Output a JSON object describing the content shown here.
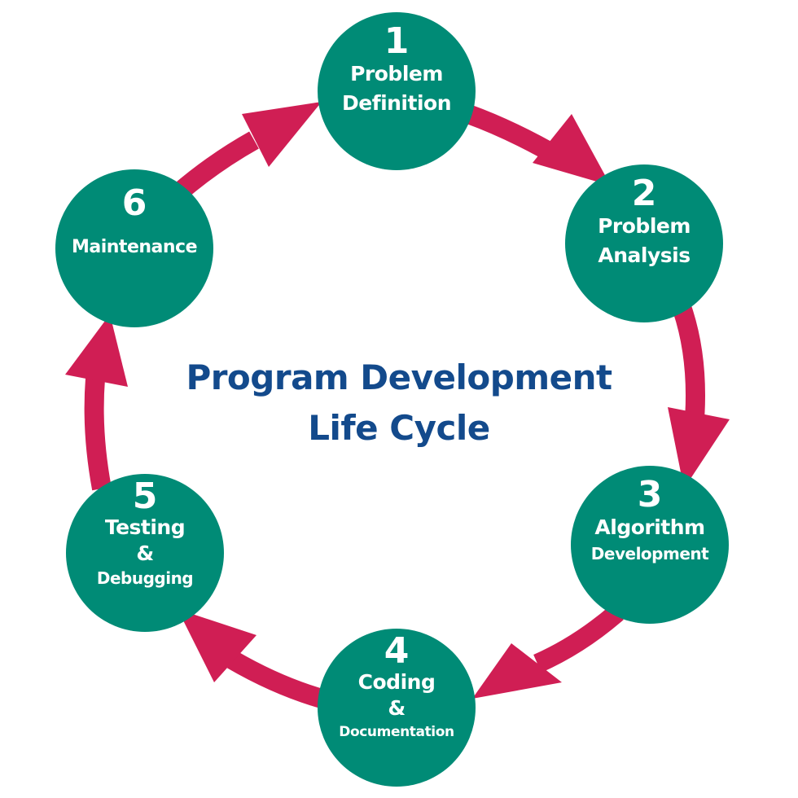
{
  "title": {
    "line1": "Program Development",
    "line2": "Life Cycle"
  },
  "colors": {
    "step_fill": "#008b76",
    "arrow": "#d01e54",
    "title": "#134a8c",
    "step_text": "#ffffff"
  },
  "steps": [
    {
      "number": "1",
      "lines": [
        "Problem",
        "Definition"
      ]
    },
    {
      "number": "2",
      "lines": [
        "Problem",
        "Analysis"
      ]
    },
    {
      "number": "3",
      "lines": [
        "Algorithm",
        "Development"
      ]
    },
    {
      "number": "4",
      "lines": [
        "Coding",
        "&",
        "Documentation"
      ]
    },
    {
      "number": "5",
      "lines": [
        "Testing",
        "&",
        "Debugging"
      ]
    },
    {
      "number": "6",
      "lines": [
        "",
        "Maintenance"
      ]
    }
  ],
  "arrows": [
    {
      "from": "1",
      "to": "2"
    },
    {
      "from": "2",
      "to": "3"
    },
    {
      "from": "3",
      "to": "4"
    },
    {
      "from": "4",
      "to": "5"
    },
    {
      "from": "5",
      "to": "6"
    },
    {
      "from": "6",
      "to": "1"
    }
  ]
}
